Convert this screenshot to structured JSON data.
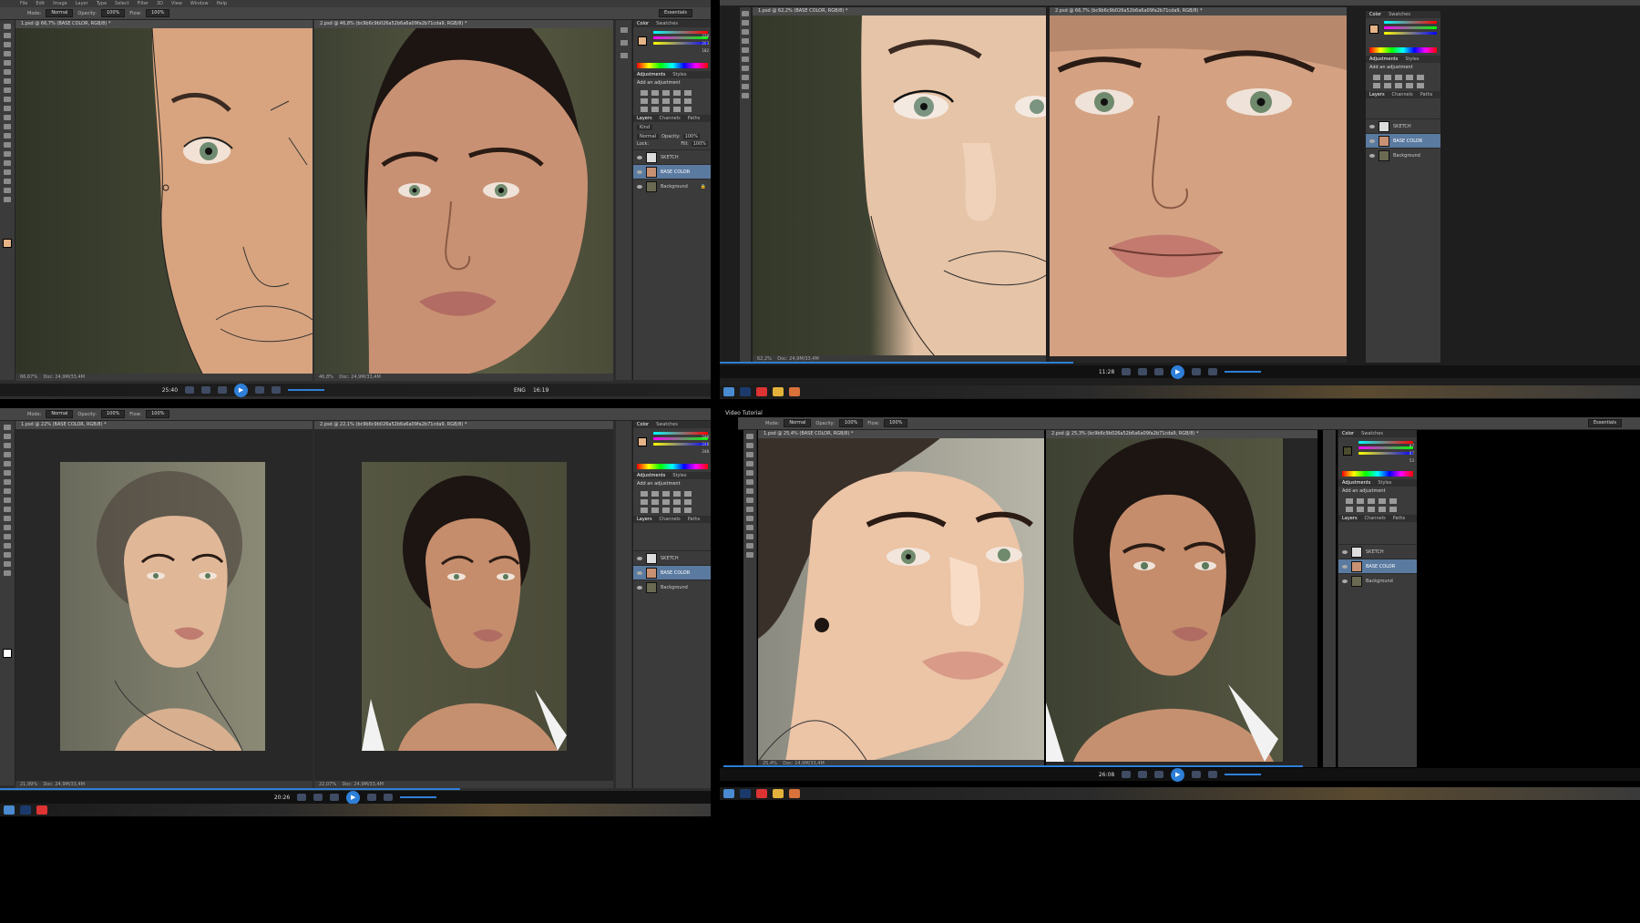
{
  "menu": [
    "File",
    "Edit",
    "Image",
    "Layer",
    "Type",
    "Select",
    "Filter",
    "3D",
    "View",
    "Window",
    "Help"
  ],
  "workspace": "Essentials",
  "options": {
    "mode_label": "Mode:",
    "mode_value": "Normal",
    "opacity_label": "Opacity:",
    "opacity_value": "100%",
    "flow_label": "Flow:",
    "flow_value": "100%"
  },
  "panels": {
    "color_tabs": [
      "Color",
      "Swatches"
    ],
    "rgb_values": [
      "228",
      "203",
      "182"
    ],
    "adj_tabs": [
      "Adjustments",
      "Styles"
    ],
    "adj_title": "Add an adjustment",
    "layer_tabs": [
      "Layers",
      "Channels",
      "Paths"
    ],
    "kind": "Kind",
    "blend": "Normal",
    "opacity_label": "Opacity:",
    "opacity_value": "100%",
    "lock_label": "Lock:",
    "fill_label": "Fill:",
    "fill_value": "100%",
    "layers": [
      "SKETCH",
      "BASE COLOR",
      "Background"
    ]
  },
  "q1": {
    "doc1": "1.psd @ 66,7% (BASE COLOR, RGB/8) *",
    "doc2": "2.psd @ 46,8% (bc9b6c9b026a52b6a6a09fa2b71cda9, RGB/8) *",
    "zoom1": "66,67%",
    "doc_size": "Doc: 24,9M/33,4M",
    "zoom2": "46,8%",
    "time": "25:40",
    "clock": "16:19"
  },
  "q2": {
    "doc1": "1.psd @ 62,2% (BASE COLOR, RGB/8) *",
    "doc2": "2.psd @ 66,7% (bc9b6c9b026a52b6a6a09fa2b71cda9, RGB/8) *",
    "zoom1": "62,2%",
    "doc_size": "Doc: 24,9M/33,4M",
    "time": "11:28"
  },
  "q3": {
    "doc1": "1.psd @ 22% (BASE COLOR, RGB/8) *",
    "doc2": "2.psd @ 22,1% (bc9b6c9b026a52b6a6a09fa2b71cda9, RGB/8) *",
    "zoom1": "21,99%",
    "doc_size": "Doc: 24,9M/33,4M",
    "zoom2": "22,07%",
    "time": "20:26",
    "rgb_values": [
      "248",
      "248",
      "248"
    ]
  },
  "q4": {
    "title": "Video Tutorial",
    "doc1": "1.psd @ 25,4% (BASE COLOR, RGB/8) *",
    "doc2": "2.psd @ 25,3% (bc9b6c9b026a52b6a6a09fa2b71cda9, RGB/8) *",
    "zoom1": "25,4%",
    "doc_size": "Doc: 24,9M/33,4M",
    "time": "26:08",
    "rgb_values": [
      "87",
      "87",
      "53"
    ]
  },
  "taskbar": {
    "lang": "ENG"
  }
}
